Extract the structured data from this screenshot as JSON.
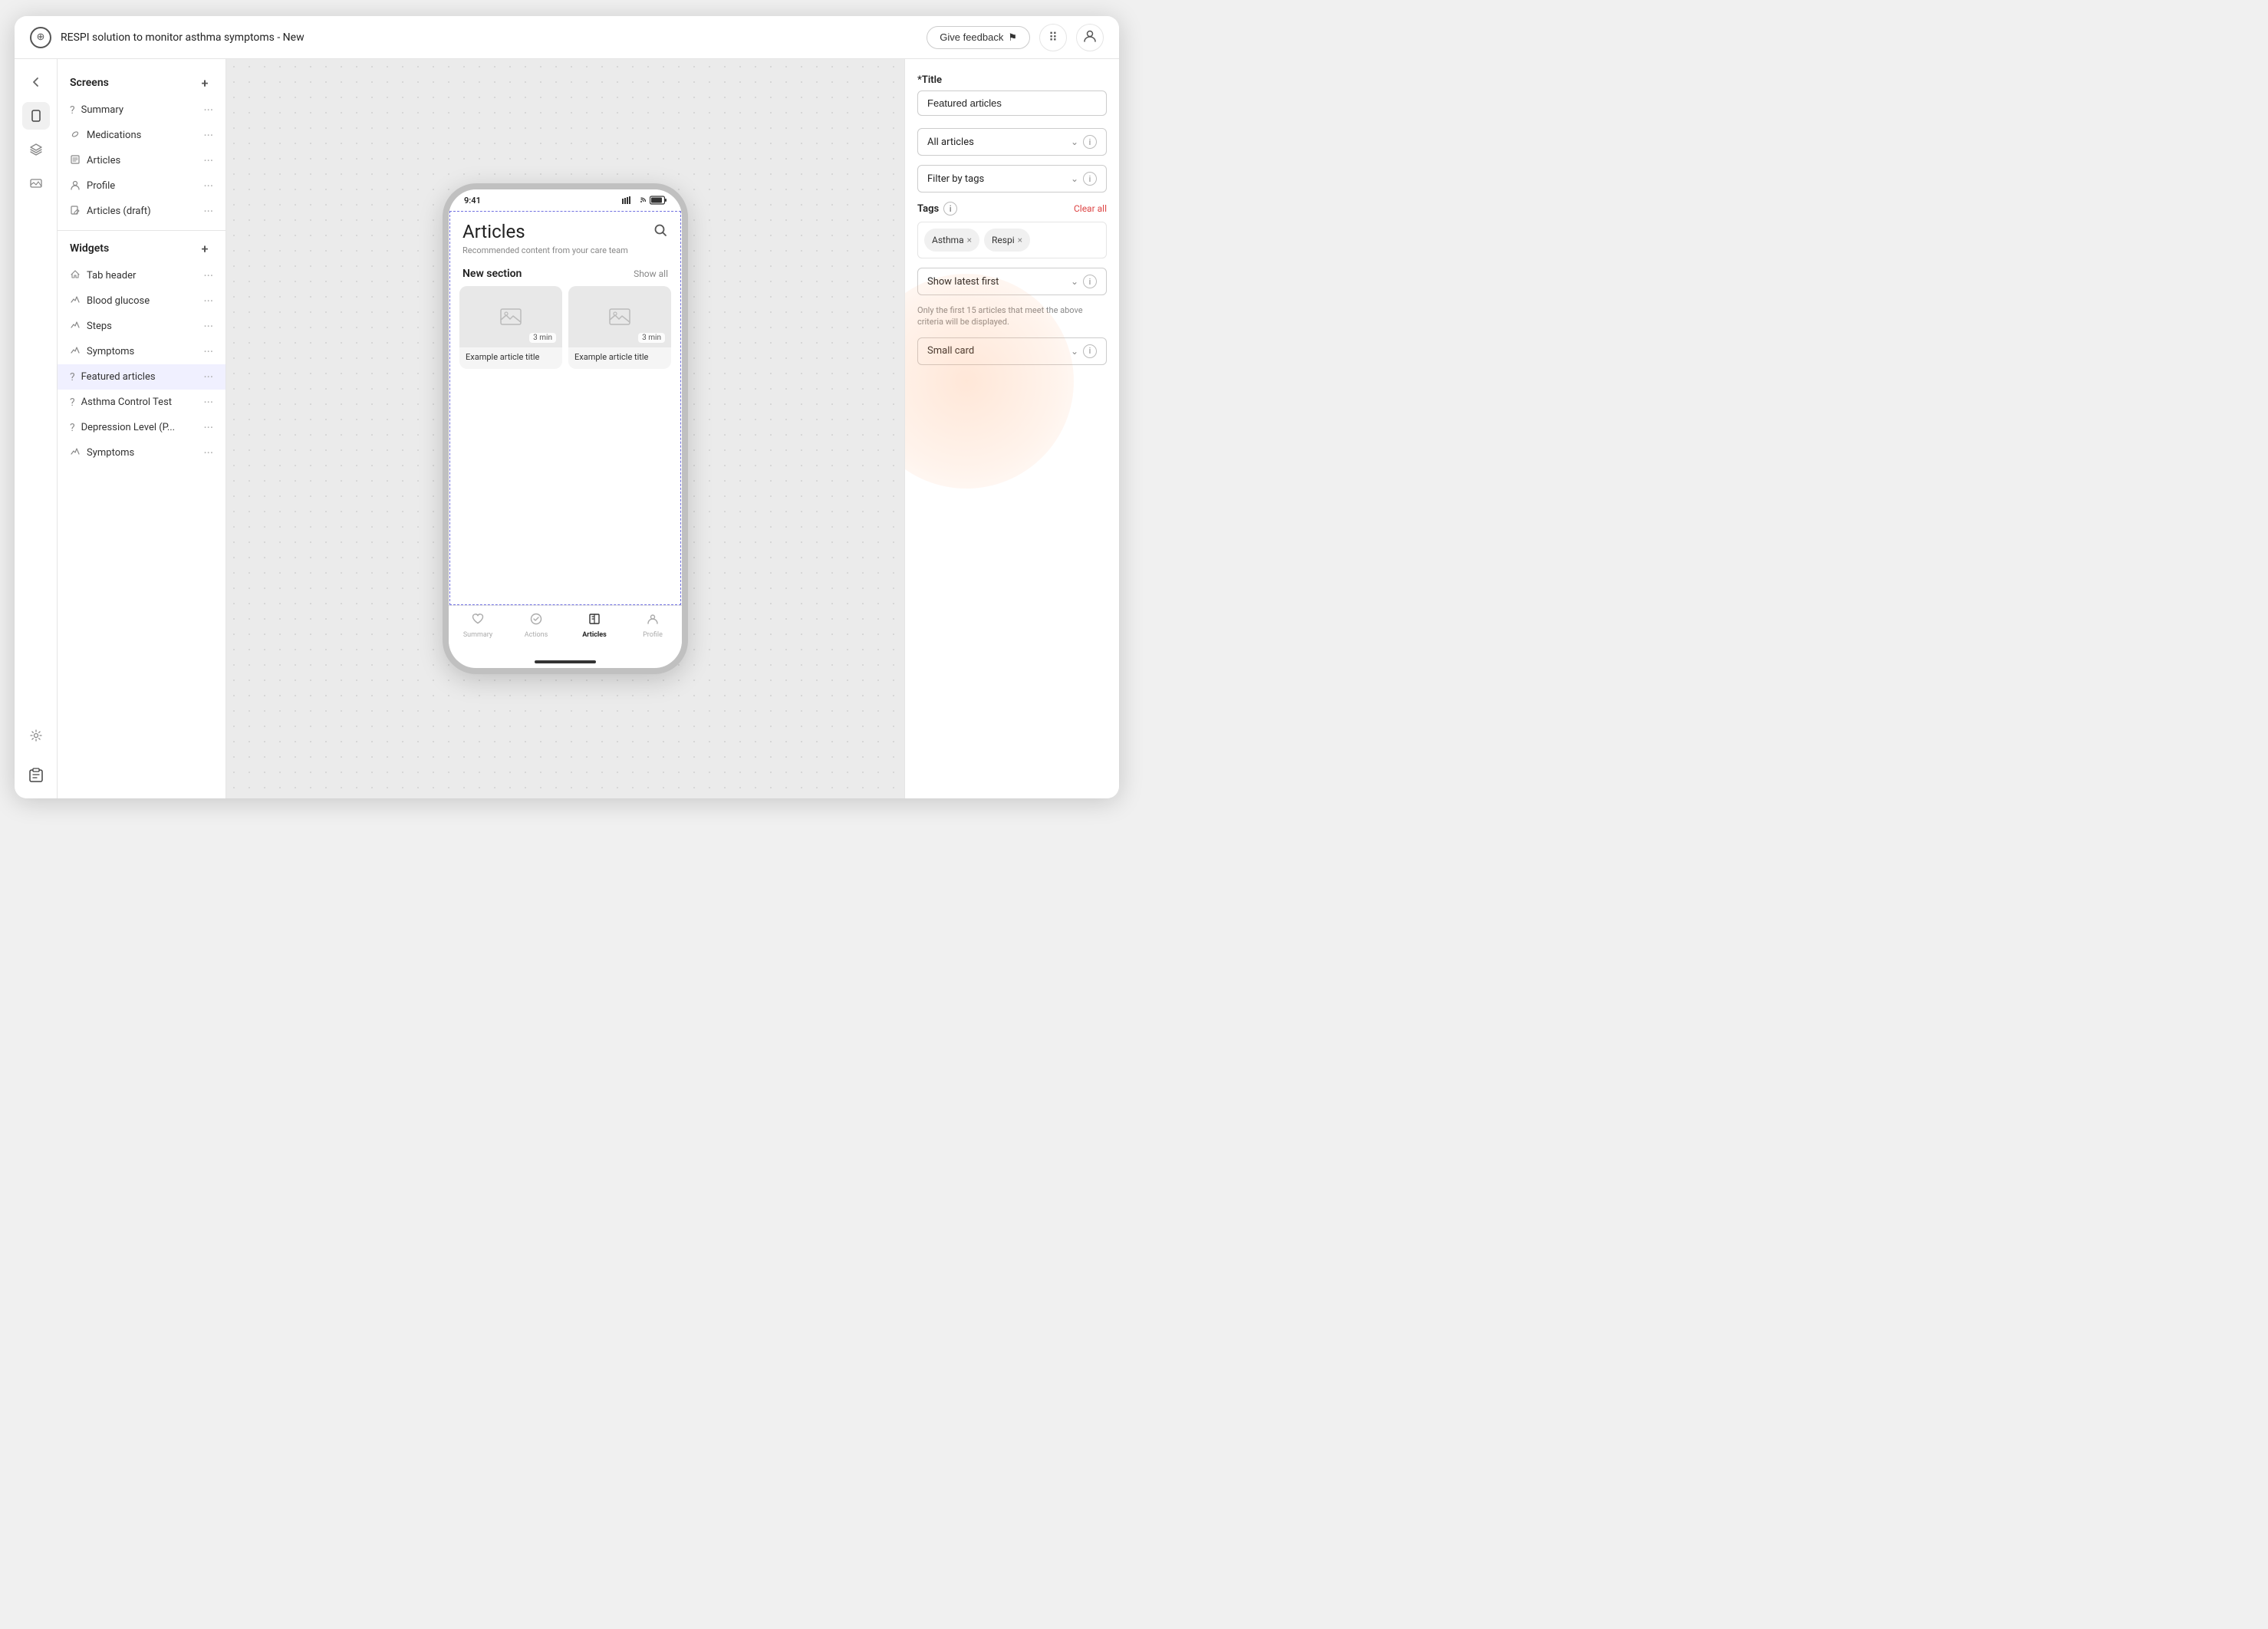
{
  "app": {
    "title": "RESPI solution to monitor asthma symptoms - New",
    "logo_symbol": "⊕"
  },
  "topbar": {
    "feedback_label": "Give feedback",
    "feedback_icon": "⚑",
    "grid_icon": "⋮⋮⋮",
    "user_icon": "👤"
  },
  "rail": {
    "back_icon": "←",
    "phone_icon": "📱",
    "layers_icon": "◫",
    "image_icon": "🖼",
    "settings_icon": "⚙",
    "bottom_icon": "📋"
  },
  "sidebar": {
    "screens_label": "Screens",
    "widgets_label": "Widgets",
    "screens": [
      {
        "label": "Summary",
        "icon": "?",
        "active": false
      },
      {
        "label": "Medications",
        "icon": "💊"
      },
      {
        "label": "Articles",
        "icon": "📖"
      },
      {
        "label": "Profile",
        "icon": "👤"
      },
      {
        "label": "Articles (draft)",
        "icon": "📄"
      }
    ],
    "widgets": [
      {
        "label": "Tab header",
        "icon": "⌶"
      },
      {
        "label": "Blood glucose",
        "icon": "⌶"
      },
      {
        "label": "Steps",
        "icon": "⌶"
      },
      {
        "label": "Symptoms",
        "icon": "⌶"
      },
      {
        "label": "Featured articles",
        "icon": "?",
        "active": true
      },
      {
        "label": "Asthma Control Test",
        "icon": "?"
      },
      {
        "label": "Depression Level (P...",
        "icon": "?"
      },
      {
        "label": "Symptoms",
        "icon": "⌶"
      }
    ]
  },
  "phone": {
    "time": "9:41",
    "status_icons": "▌▌ ☁ 🔋",
    "page_title": "Articles",
    "search_icon": "🔍",
    "subtitle": "Recommended content from your care team",
    "section_title": "New section",
    "show_all": "Show all",
    "card1": {
      "duration": "3 min",
      "title": "Example article title"
    },
    "card2": {
      "duration": "3 min",
      "title": "Example article title"
    },
    "nav": {
      "summary": "Summary",
      "actions": "Actions",
      "articles": "Articles",
      "profile": "Profile"
    }
  },
  "right_panel": {
    "title_label": "*Title",
    "title_value": "Featured articles",
    "filter_label": "All articles",
    "filter_tags_label": "Filter by tags",
    "tags_label": "Tags",
    "clear_all": "Clear all",
    "tags": [
      {
        "label": "Asthma"
      },
      {
        "label": "Respi"
      }
    ],
    "sort_label": "Show latest first",
    "hint": "Only the first 15 articles that meet the above criteria will be displayed.",
    "display_label": "Small card"
  }
}
